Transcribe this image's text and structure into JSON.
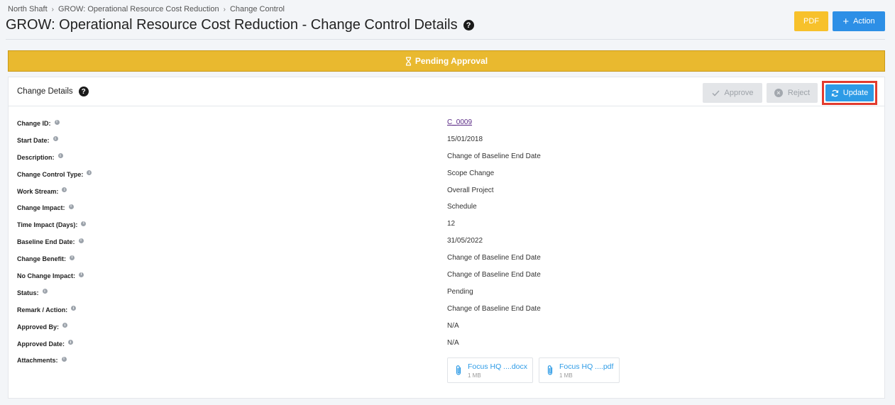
{
  "breadcrumb": [
    "North Shaft",
    "GROW: Operational Resource Cost Reduction",
    "Change Control"
  ],
  "page_title": "GROW: Operational Resource Cost Reduction - Change Control Details",
  "header_buttons": {
    "pdf": "PDF",
    "action": "Action"
  },
  "status_banner": "Pending Approval",
  "panel": {
    "title": "Change Details",
    "approve": "Approve",
    "reject": "Reject",
    "update": "Update"
  },
  "details": [
    {
      "label": "Change ID:",
      "value": "C_0009"
    },
    {
      "label": "Start Date:",
      "value": "15/01/2018"
    },
    {
      "label": "Description:",
      "value": "Change of Baseline End Date"
    },
    {
      "label": "Change Control Type:",
      "value": "Scope Change"
    },
    {
      "label": "Work Stream:",
      "value": "Overall Project"
    },
    {
      "label": "Change Impact:",
      "value": "Schedule"
    },
    {
      "label": "Time Impact (Days):",
      "value": "12"
    },
    {
      "label": "Baseline End Date:",
      "value": "31/05/2022"
    },
    {
      "label": "Change Benefit:",
      "value": "Change of Baseline End Date"
    },
    {
      "label": "No Change Impact:",
      "value": "Change of Baseline End Date"
    },
    {
      "label": "Status:",
      "value": "Pending"
    },
    {
      "label": "Remark / Action:",
      "value": "Change of Baseline End Date"
    },
    {
      "label": "Approved By:",
      "value": "N/A"
    },
    {
      "label": "Approved Date:",
      "value": "N/A"
    },
    {
      "label": "Attachments:",
      "value": ""
    }
  ],
  "attachments": [
    {
      "name": "Focus HQ ....docx",
      "size": "1 MB"
    },
    {
      "name": "Focus HQ ....pdf",
      "size": "1 MB"
    }
  ],
  "colors": {
    "banner": "#e9b92f",
    "pdf_button": "#f7c12b",
    "action_button": "#2d8fe6",
    "highlight": "#e23b2e"
  }
}
